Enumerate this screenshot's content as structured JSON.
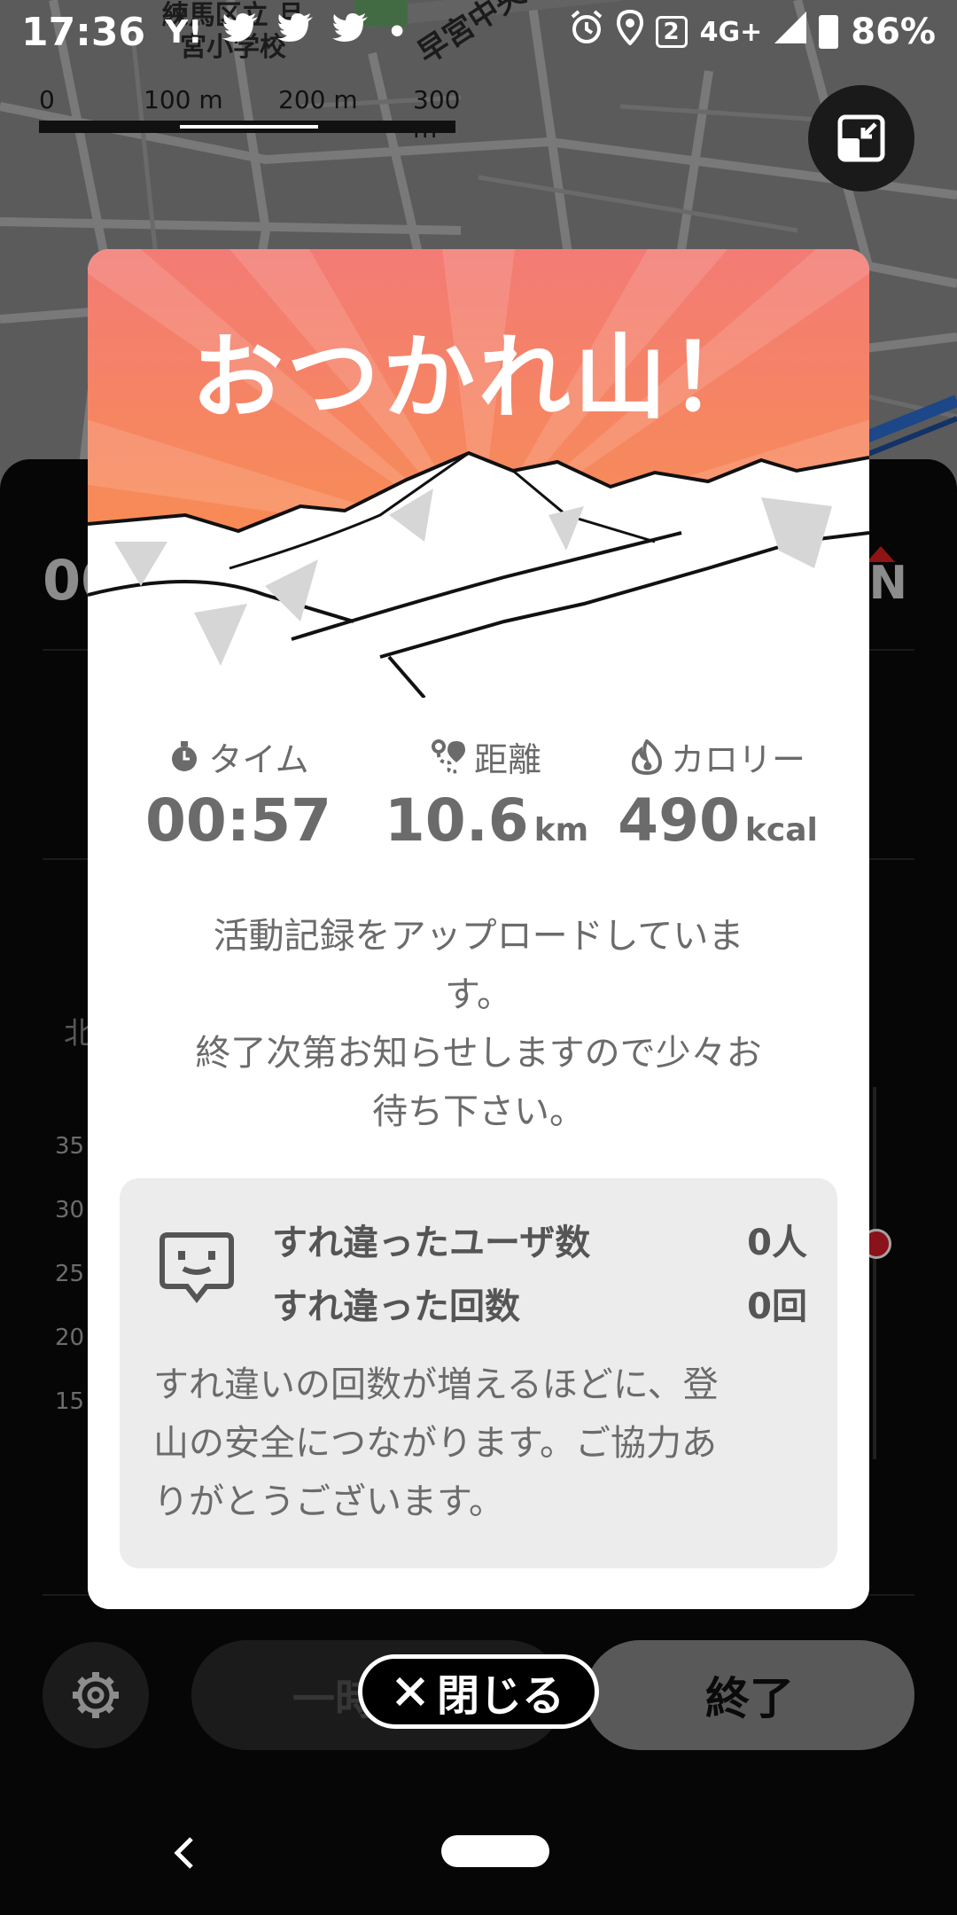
{
  "status_bar": {
    "time": "17:36",
    "notification_icons": [
      "Y!",
      "twitter-icon",
      "twitter-icon",
      "twitter-icon",
      "•"
    ],
    "sim_badge": "2",
    "network": "4G+",
    "battery": "86%"
  },
  "map": {
    "school_label_line1": "練馬区立 旦",
    "school_label_line2": "宮小学校",
    "road_label": "早宮中央通り",
    "scale_labels": [
      "0",
      "100 m",
      "200 m",
      "300 m"
    ]
  },
  "background_panel": {
    "elapsed_time": "00",
    "north_label": "N",
    "north_text": "北",
    "chart_y_labels": [
      "35",
      "30",
      "25",
      "20",
      "15"
    ],
    "pause_button": "一時停止",
    "end_button": "終了"
  },
  "modal": {
    "title": "おつかれ山！",
    "stats": {
      "time": {
        "label": "タイム",
        "value": "00:57",
        "unit": ""
      },
      "distance": {
        "label": "距離",
        "value": "10.6",
        "unit": "km"
      },
      "calorie": {
        "label": "カロリー",
        "value": "490",
        "unit": "kcal"
      }
    },
    "upload_message_line1": "活動記録をアップロードしていま",
    "upload_message_line2": "す。",
    "upload_message_line3": "終了次第お知らせしますので少々お",
    "upload_message_line4": "待ち下さい。",
    "passing": {
      "users_label": "すれ違ったユーザ数",
      "users_value": "0人",
      "count_label": "すれ違った回数",
      "count_value": "0回",
      "note_line1": "すれ違いの回数が増えるほどに、登",
      "note_line2": "山の安全につながります。ご協力あ",
      "note_line3": "りがとうございます。"
    }
  },
  "close_button": {
    "label": "閉じる"
  },
  "colors": {
    "hero_top": "#f37b75",
    "hero_bottom": "#fb8c3a",
    "card_bg": "#ececec",
    "text_gray": "#6b6b6b"
  }
}
